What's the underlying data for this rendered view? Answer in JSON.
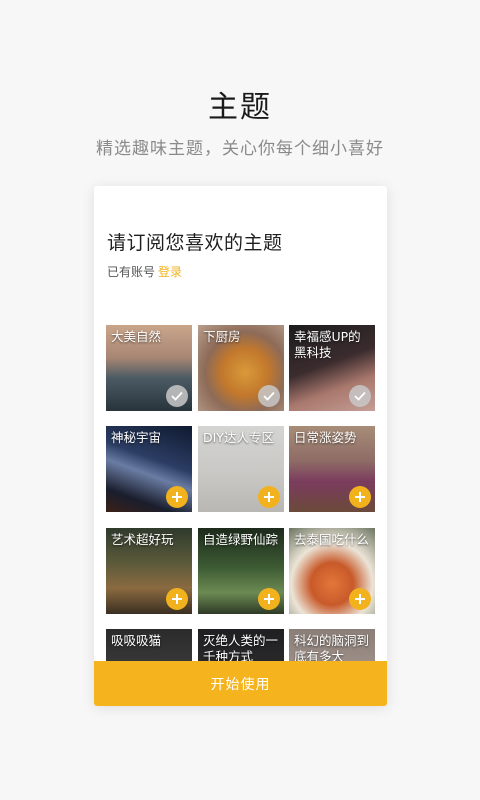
{
  "header": {
    "title": "主题",
    "subtitle": "精选趣味主题，关心你每个细小喜好"
  },
  "card": {
    "heading": "请订阅您喜欢的主题",
    "account_prompt": "已有账号",
    "login_link": "登录",
    "start_button": "开始使用"
  },
  "colors": {
    "accent": "#f5b41e",
    "checked_badge": "#c8c8c8"
  },
  "topics": [
    {
      "label": "大美自然",
      "state": "subscribed",
      "icon": "check-icon"
    },
    {
      "label": "下厨房",
      "state": "subscribed",
      "icon": "check-icon"
    },
    {
      "label": "幸福感UP的黑科技",
      "state": "subscribed",
      "icon": "check-icon"
    },
    {
      "label": "神秘宇宙",
      "state": "unsubscribed",
      "icon": "plus-icon"
    },
    {
      "label": "DIY达人专区",
      "state": "unsubscribed",
      "icon": "plus-icon"
    },
    {
      "label": "日常涨姿势",
      "state": "unsubscribed",
      "icon": "plus-icon"
    },
    {
      "label": "艺术超好玩",
      "state": "unsubscribed",
      "icon": "plus-icon"
    },
    {
      "label": "自造绿野仙踪",
      "state": "unsubscribed",
      "icon": "plus-icon"
    },
    {
      "label": "去泰国吃什么",
      "state": "unsubscribed",
      "icon": "plus-icon"
    },
    {
      "label": "吸吸吸猫",
      "state": "unsubscribed",
      "icon": "plus-icon"
    },
    {
      "label": "灭绝人类的一千种方式",
      "state": "unsubscribed",
      "icon": "plus-icon"
    },
    {
      "label": "科幻的脑洞到底有多大",
      "state": "unsubscribed",
      "icon": "plus-icon"
    }
  ]
}
